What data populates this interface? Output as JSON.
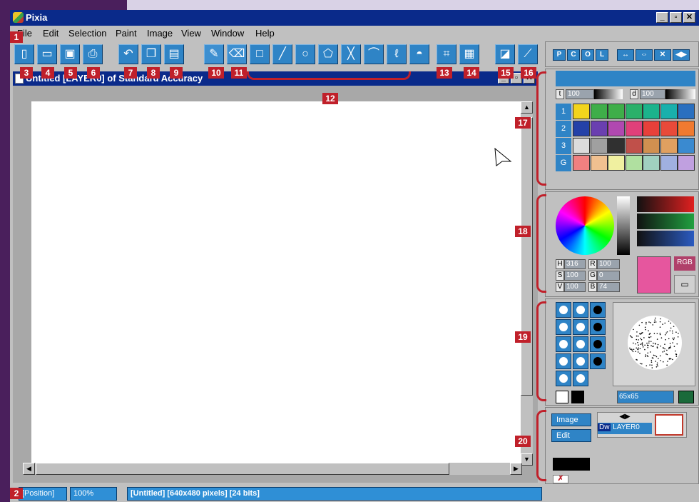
{
  "app": {
    "title": "Pixia",
    "window_buttons": [
      "_",
      "▫",
      "✕"
    ]
  },
  "menu": [
    "File",
    "Edit",
    "Selection",
    "Paint",
    "Image",
    "View",
    "Window",
    "Help"
  ],
  "document": {
    "title": "Untitled [LAYER0] of Standard Accuracy"
  },
  "panel_tabs": [
    "P",
    "C",
    "O",
    "L"
  ],
  "panel_extra_buttons": [
    "↔",
    "⇔",
    "✕",
    "◀▶"
  ],
  "pen_panel": {
    "t_label": "t",
    "t_value": "100",
    "d_label": "d",
    "d_value": "100",
    "rows": [
      "1",
      "2",
      "3",
      "G"
    ]
  },
  "color_panel": {
    "h_label": "H",
    "h_value": "316",
    "s_label": "S",
    "s_value": "100",
    "v_label": "V",
    "v_value": "100",
    "r_label": "R",
    "r_value": "100",
    "g_label": "G",
    "g_value": "0",
    "b_label": "B",
    "b_value": "74",
    "mode": "RGB",
    "current_color": "#e6569e"
  },
  "brush_panel": {
    "size": "65x65"
  },
  "layer_panel": {
    "image_button": "Image",
    "edit_button": "Edit",
    "layer_name": "LAYER0",
    "layer_prefix": "Dw"
  },
  "status": {
    "position": "[Position]",
    "zoom": "100%",
    "info": "[Untitled] [640x480 pixels] [24 bits]"
  },
  "callouts": [
    "1",
    "2",
    "3",
    "4",
    "5",
    "6",
    "7",
    "8",
    "9",
    "10",
    "11",
    "12",
    "13",
    "14",
    "15",
    "16",
    "17",
    "18",
    "19",
    "20"
  ],
  "palette": {
    "row1": [
      "#f3d41c",
      "#3fae49",
      "#3fae49",
      "#2bb06a",
      "#1bb38c",
      "#19b0ac",
      "#2a6fbf"
    ],
    "row2": [
      "#2441a8",
      "#6a3fb0",
      "#b048b0",
      "#e0407a",
      "#e8403a",
      "#e84a3a",
      "#f07a30"
    ],
    "row3": [
      "#dcdcdc",
      "#a0a0a0",
      "#303030",
      "#c0504a",
      "#d09050",
      "#e0a060",
      "#3a8ad0"
    ],
    "rowG": [
      "#f08080",
      "#f0c090",
      "#f0f0a0",
      "#b0e0a0",
      "#a0d0c0",
      "#a0b0e0",
      "#c0a0e0"
    ]
  }
}
